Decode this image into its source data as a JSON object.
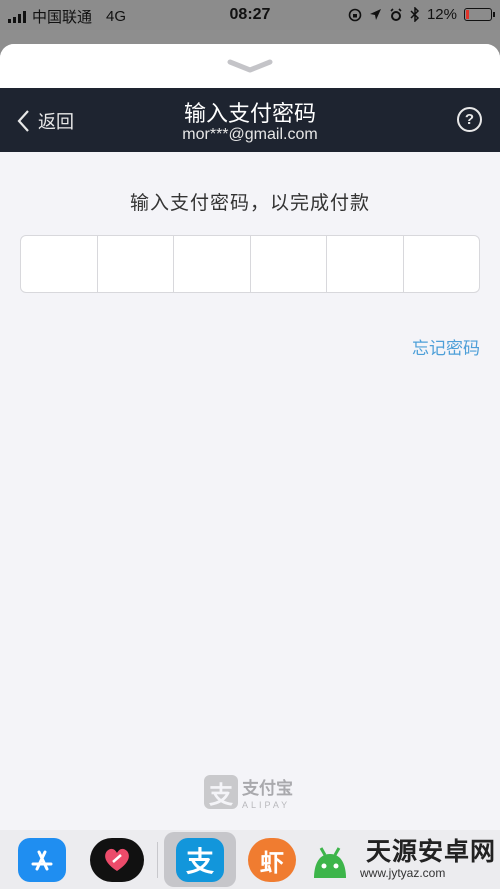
{
  "status_bar": {
    "carrier": "中国联通",
    "network": "4G",
    "time": "08:27",
    "battery": "12%",
    "battery_level": 0.12,
    "icons": [
      "orientation-lock-icon",
      "location-icon",
      "alarm-icon",
      "bluetooth-icon",
      "battery-icon"
    ]
  },
  "header": {
    "back_label": "返回",
    "title": "输入支付密码",
    "account": "mor***@gmail.com",
    "help_label": "?"
  },
  "main": {
    "prompt": "输入支付密码，以完成付款",
    "pin_length": 6,
    "forgot_label": "忘记密码"
  },
  "logo": {
    "cn": "支付宝",
    "en": "ALIPAY",
    "mark": "支"
  },
  "dock": {
    "apps": [
      {
        "name": "app-store-icon",
        "color": "#1f8ef1"
      },
      {
        "name": "health-icon",
        "color": "#111111"
      },
      {
        "name": "alipay-icon",
        "color": "#1296db",
        "glyph": "支"
      },
      {
        "name": "xiami-icon",
        "color": "#f07c30",
        "glyph": "虾"
      },
      {
        "name": "android-icon",
        "color": "#3db54a"
      }
    ]
  },
  "watermark": {
    "text": "天源安卓网",
    "url": "www.jytyaz.com"
  }
}
